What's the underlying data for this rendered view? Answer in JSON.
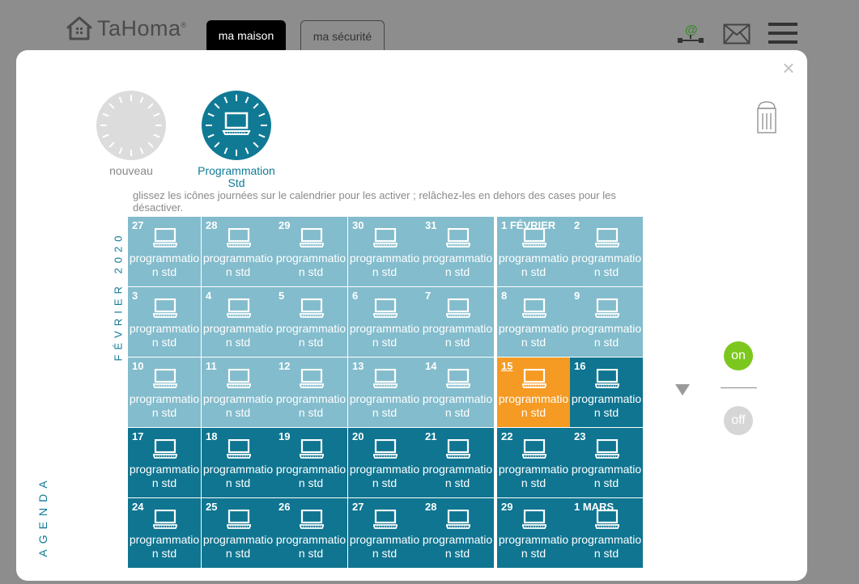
{
  "header": {
    "logo_text": "TaHoma",
    "logo_reg": "®",
    "tabs": [
      {
        "label": "ma maison"
      },
      {
        "label": "ma sécurité"
      }
    ]
  },
  "modal": {
    "close_label": "×",
    "chips": {
      "new_label": "nouveau",
      "std_label_line1": "Programmation",
      "std_label_line2": "Std"
    },
    "instructions": "glissez les icônes journées sur le calendrier pour les activer ; relâchez-les en dehors des cases pour les désactiver.",
    "month_label": "FÉVRIER 2020",
    "agenda_label": "AGENDA",
    "toggle": {
      "on_label": "on",
      "off_label": "off"
    },
    "calendar": {
      "day_text": "programmation std",
      "rows": [
        [
          {
            "label": "27",
            "style": "light"
          },
          {
            "label": "28",
            "style": "light"
          },
          {
            "label": "29",
            "style": "light"
          },
          {
            "label": "30",
            "style": "light"
          },
          {
            "label": "31",
            "style": "light"
          },
          {
            "label": "1 FÉVRIER",
            "style": "light"
          },
          {
            "label": "2",
            "style": "light"
          }
        ],
        [
          {
            "label": "3",
            "style": "light"
          },
          {
            "label": "4",
            "style": "light"
          },
          {
            "label": "5",
            "style": "light"
          },
          {
            "label": "6",
            "style": "light"
          },
          {
            "label": "7",
            "style": "light"
          },
          {
            "label": "8",
            "style": "light"
          },
          {
            "label": "9",
            "style": "light"
          }
        ],
        [
          {
            "label": "10",
            "style": "light"
          },
          {
            "label": "11",
            "style": "light"
          },
          {
            "label": "12",
            "style": "light"
          },
          {
            "label": "13",
            "style": "light"
          },
          {
            "label": "14",
            "style": "light"
          },
          {
            "label": "15",
            "style": "today"
          },
          {
            "label": "16",
            "style": "dark"
          }
        ],
        [
          {
            "label": "17",
            "style": "dark"
          },
          {
            "label": "18",
            "style": "dark"
          },
          {
            "label": "19",
            "style": "dark"
          },
          {
            "label": "20",
            "style": "dark"
          },
          {
            "label": "21",
            "style": "dark"
          },
          {
            "label": "22",
            "style": "dark"
          },
          {
            "label": "23",
            "style": "dark"
          }
        ],
        [
          {
            "label": "24",
            "style": "dark"
          },
          {
            "label": "25",
            "style": "dark"
          },
          {
            "label": "26",
            "style": "dark"
          },
          {
            "label": "27",
            "style": "dark"
          },
          {
            "label": "28",
            "style": "dark"
          },
          {
            "label": "29",
            "style": "dark"
          },
          {
            "label": "1 MARS",
            "style": "dark"
          }
        ]
      ]
    }
  },
  "icons": {
    "home": "home-icon",
    "network": "network-at-icon",
    "mail": "envelope-icon",
    "menu": "hamburger-menu-icon",
    "trash": "trash-bin-icon",
    "laptop": "laptop-icon",
    "arrow": "arrow-down-icon"
  },
  "colors": {
    "teal_dark": "#0f7591",
    "teal_light": "#83bccc",
    "today_orange": "#f59a23",
    "on_green": "#7cc71e",
    "off_grey": "#d6d6d6"
  }
}
